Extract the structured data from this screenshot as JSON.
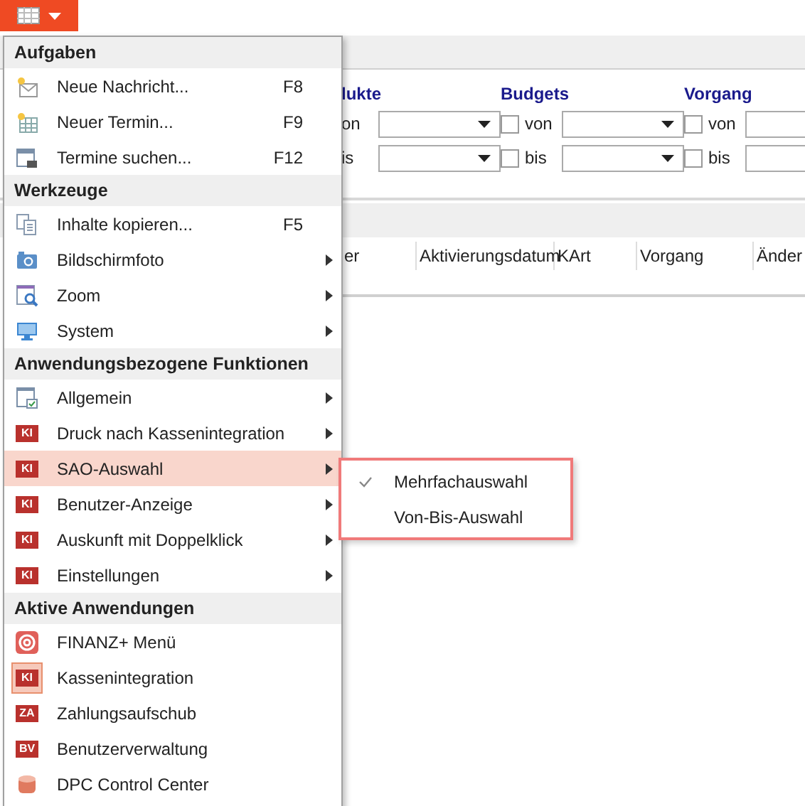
{
  "filters": [
    {
      "title": "lukte",
      "rows": [
        {
          "label": "on"
        },
        {
          "label": "is"
        }
      ]
    },
    {
      "title": "Budgets",
      "rows": [
        {
          "label": "von",
          "checked": false
        },
        {
          "label": "bis",
          "checked": false
        }
      ]
    },
    {
      "title": "Vorgang",
      "rows": [
        {
          "label": "von",
          "checked": false
        },
        {
          "label": "bis",
          "checked": false
        }
      ]
    }
  ],
  "table": {
    "columns": [
      "er",
      "Aktivierungsdatum",
      "KArt",
      "Vorgang",
      "Änder"
    ]
  },
  "menu": {
    "sections": [
      {
        "title": "Aufgaben",
        "items": [
          {
            "label": "Neue Nachricht...",
            "kind": "new-mail",
            "shortcut": "F8",
            "has_submenu": false,
            "selected": false,
            "active": false
          },
          {
            "label": "Neuer Termin...",
            "kind": "new-calendar",
            "shortcut": "F9",
            "has_submenu": false,
            "selected": false,
            "active": false
          },
          {
            "label": "Termine suchen...",
            "kind": "find-calendar",
            "shortcut": "F12",
            "has_submenu": false,
            "selected": false,
            "active": false
          }
        ]
      },
      {
        "title": "Werkzeuge",
        "items": [
          {
            "label": "Inhalte kopieren...",
            "kind": "copy",
            "shortcut": "F5",
            "has_submenu": false,
            "selected": false,
            "active": false
          },
          {
            "label": "Bildschirmfoto",
            "kind": "camera",
            "has_submenu": true,
            "selected": false,
            "active": false
          },
          {
            "label": "Zoom",
            "kind": "zoom",
            "has_submenu": true,
            "selected": false,
            "active": false
          },
          {
            "label": "System",
            "kind": "monitor",
            "has_submenu": true,
            "selected": false,
            "active": false
          }
        ]
      },
      {
        "title": "Anwendungsbezogene Funktionen",
        "items": [
          {
            "label": "Allgemein",
            "kind": "window-check",
            "has_submenu": true,
            "selected": false,
            "active": false
          },
          {
            "label": "Druck nach Kassenintegration",
            "kind": "badge",
            "badge": "KI",
            "has_submenu": true,
            "selected": false,
            "active": false
          },
          {
            "label": "SAO-Auswahl",
            "kind": "badge",
            "badge": "KI",
            "has_submenu": true,
            "selected": true,
            "active": false
          },
          {
            "label": "Benutzer-Anzeige",
            "kind": "badge",
            "badge": "KI",
            "has_submenu": true,
            "selected": false,
            "active": false
          },
          {
            "label": "Auskunft mit Doppelklick",
            "kind": "badge",
            "badge": "KI",
            "has_submenu": true,
            "selected": false,
            "active": false
          },
          {
            "label": "Einstellungen",
            "kind": "badge",
            "badge": "KI",
            "has_submenu": true,
            "selected": false,
            "active": false
          }
        ]
      },
      {
        "title": "Aktive Anwendungen",
        "items": [
          {
            "label": "FINANZ+ Menü",
            "kind": "at",
            "has_submenu": false,
            "selected": false,
            "active": false
          },
          {
            "label": "Kassenintegration",
            "kind": "badge",
            "badge": "KI",
            "has_submenu": false,
            "selected": false,
            "active": true
          },
          {
            "label": "Zahlungsaufschub",
            "kind": "badge",
            "badge": "ZA",
            "has_submenu": false,
            "selected": false,
            "active": false
          },
          {
            "label": "Benutzerverwaltung",
            "kind": "badge",
            "badge": "BV",
            "has_submenu": false,
            "selected": false,
            "active": false
          },
          {
            "label": "DPC Control Center",
            "kind": "database",
            "has_submenu": false,
            "selected": false,
            "active": false
          }
        ]
      }
    ]
  },
  "submenu": {
    "items": [
      {
        "label": "Mehrfachauswahl",
        "checked": true
      },
      {
        "label": "Von-Bis-Auswahl",
        "checked": false
      }
    ]
  }
}
